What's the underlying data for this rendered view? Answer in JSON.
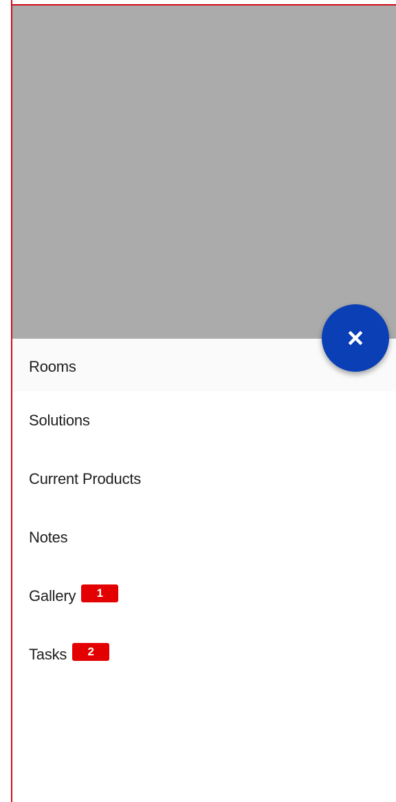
{
  "fab": {
    "icon": "close-icon",
    "color": "#0a3fb5"
  },
  "header": {
    "background_color": "#ababab"
  },
  "menu": {
    "items": [
      {
        "label": "Rooms",
        "badge": null
      },
      {
        "label": "Solutions",
        "badge": null
      },
      {
        "label": "Current Products",
        "badge": null
      },
      {
        "label": "Notes",
        "badge": null
      },
      {
        "label": "Gallery",
        "badge": "1"
      },
      {
        "label": "Tasks",
        "badge": "2"
      }
    ]
  },
  "colors": {
    "badge": "#e30000",
    "frame_border": "#d10b17"
  }
}
